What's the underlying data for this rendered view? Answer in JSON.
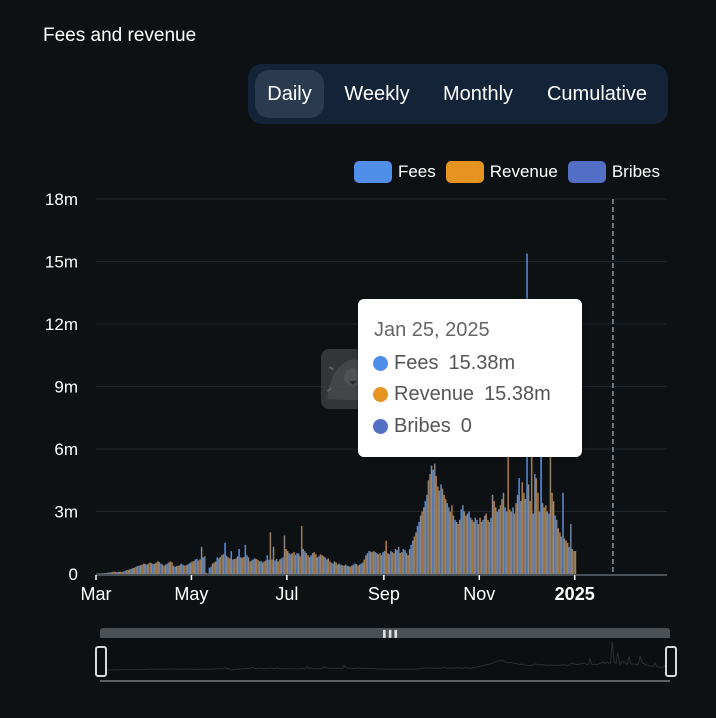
{
  "header": {
    "title": "Fees and revenue"
  },
  "range_tabs": [
    {
      "label": "Daily",
      "active": true
    },
    {
      "label": "Weekly",
      "active": false
    },
    {
      "label": "Monthly",
      "active": false
    },
    {
      "label": "Cumulative",
      "active": false
    }
  ],
  "legend": [
    {
      "label": "Fees",
      "color": "#4f8fea"
    },
    {
      "label": "Revenue",
      "color": "#e59421"
    },
    {
      "label": "Bribes",
      "color": "#5470c6"
    }
  ],
  "tooltip": {
    "date": "Jan 25, 2025",
    "rows": [
      {
        "label": "Fees",
        "value": "15.38m",
        "color": "#4f8fea"
      },
      {
        "label": "Revenue",
        "value": "15.38m",
        "color": "#e59421"
      },
      {
        "label": "Bribes",
        "value": "0",
        "color": "#5470c6"
      }
    ]
  },
  "watermark": {
    "icon": "llama-logo-icon"
  },
  "chart_data": {
    "type": "bar",
    "title": "Fees and revenue",
    "xlabel": "",
    "ylabel": "",
    "ylim": [
      0,
      18000000
    ],
    "yticks": [
      "0",
      "3m",
      "6m",
      "9m",
      "12m",
      "15m",
      "18m"
    ],
    "ytick_values": [
      0,
      3000000,
      6000000,
      9000000,
      12000000,
      15000000,
      18000000
    ],
    "xticks": [
      "Mar",
      "May",
      "Jul",
      "Sep",
      "Nov",
      "2025"
    ],
    "xtick_bold": [
      false,
      false,
      false,
      false,
      false,
      true
    ],
    "grid": true,
    "legend_position": "top-right",
    "x_start": "2024-03-01",
    "x_end": "2025-02-28",
    "highlight_date": "2025-01-25",
    "series": [
      {
        "name": "Fees",
        "color": "#4f8fea"
      },
      {
        "name": "Revenue",
        "color": "#e59421"
      },
      {
        "name": "Bribes",
        "color": "#5470c6"
      }
    ],
    "daily_values_m": [
      0.02,
      0.02,
      0.03,
      0.03,
      0.04,
      0.04,
      0.05,
      0.06,
      0.07,
      0.08,
      0.1,
      0.12,
      0.1,
      0.09,
      0.1,
      0.11,
      0.1,
      0.12,
      0.15,
      0.18,
      0.2,
      0.22,
      0.25,
      0.28,
      0.3,
      0.35,
      0.38,
      0.4,
      0.42,
      0.45,
      0.5,
      0.48,
      0.45,
      0.5,
      0.55,
      0.52,
      0.48,
      0.5,
      0.55,
      0.6,
      0.58,
      0.5,
      0.45,
      0.4,
      0.45,
      0.5,
      0.55,
      0.6,
      0.58,
      0.4,
      0.35,
      0.38,
      0.4,
      0.42,
      0.5,
      0.45,
      0.4,
      0.42,
      0.45,
      0.5,
      0.55,
      0.6,
      0.62,
      0.7,
      0.72,
      0.65,
      0.7,
      1.3,
      0.8,
      0.85,
      0.05,
      0.02,
      0.3,
      0.35,
      0.5,
      0.55,
      0.6,
      0.8,
      0.75,
      0.82,
      0.9,
      0.95,
      1.5,
      0.88,
      0.8,
      0.75,
      1.1,
      0.7,
      0.72,
      0.75,
      0.85,
      1.2,
      0.8,
      0.78,
      0.82,
      1.4,
      0.9,
      0.8,
      0.6,
      0.65,
      0.7,
      0.75,
      0.72,
      0.68,
      0.6,
      0.62,
      0.55,
      0.6,
      0.65,
      0.9,
      0.68,
      2.0,
      0.7,
      1.3,
      0.65,
      0.72,
      0.6,
      0.7,
      0.75,
      0.8,
      1.85,
      1.2,
      1.1,
      1.0,
      0.95,
      1.0,
      1.05,
      0.92,
      1.0,
      0.98,
      0.85,
      2.3,
      1.2,
      1.1,
      1.0,
      0.9,
      0.8,
      0.9,
      1.0,
      1.05,
      0.95,
      0.8,
      0.85,
      0.95,
      0.9,
      0.85,
      0.8,
      0.7,
      0.75,
      0.6,
      0.55,
      0.5,
      0.6,
      0.55,
      0.45,
      0.5,
      0.45,
      0.42,
      0.4,
      0.45,
      0.4,
      0.38,
      0.35,
      0.4,
      0.45,
      0.5,
      0.48,
      0.4,
      0.45,
      0.5,
      0.55,
      0.7,
      0.9,
      1.0,
      1.1,
      1.08,
      1.05,
      1.1,
      1.05,
      1.0,
      0.95,
      1.0,
      0.9,
      1.05,
      1.1,
      1.6,
      1.0,
      0.95,
      1.1,
      1.05,
      1.0,
      1.2,
      1.15,
      1.3,
      1.0,
      1.05,
      1.2,
      1.15,
      1.0,
      0.9,
      1.2,
      1.4,
      1.6,
      1.8,
      2.0,
      2.3,
      2.5,
      2.8,
      3.0,
      3.2,
      3.5,
      3.8,
      4.5,
      4.8,
      5.2,
      5.0,
      5.3,
      4.7,
      4.2,
      4.0,
      4.3,
      4.1,
      3.8,
      3.6,
      3.4,
      3.2,
      3.0,
      3.3,
      2.8,
      2.6,
      2.5,
      2.4,
      2.6,
      3.1,
      3.3,
      3.0,
      2.8,
      2.9,
      3.0,
      2.7,
      2.6,
      2.5,
      2.7,
      2.6,
      2.4,
      2.7,
      2.5,
      2.6,
      2.8,
      2.9,
      2.6,
      2.5,
      2.7,
      3.8,
      3.5,
      3.2,
      3.0,
      3.1,
      3.3,
      3.6,
      3.9,
      3.2,
      3.0,
      6.0,
      3.1,
      3.0,
      3.2,
      2.9,
      3.4,
      3.8,
      4.6,
      3.5,
      4.4,
      3.9,
      3.6,
      15.38,
      4.3,
      3.5,
      9.5,
      2.9,
      4.8,
      4.6,
      3.9,
      3.0,
      7.2,
      3.4,
      3.2,
      3.3,
      3.0,
      2.9,
      7.6,
      3.9,
      3.5,
      2.8,
      2.6,
      2.2,
      2.0,
      1.8,
      3.9,
      1.7,
      1.6,
      1.5,
      1.3,
      2.4,
      1.2,
      1.1,
      1.1
    ]
  }
}
